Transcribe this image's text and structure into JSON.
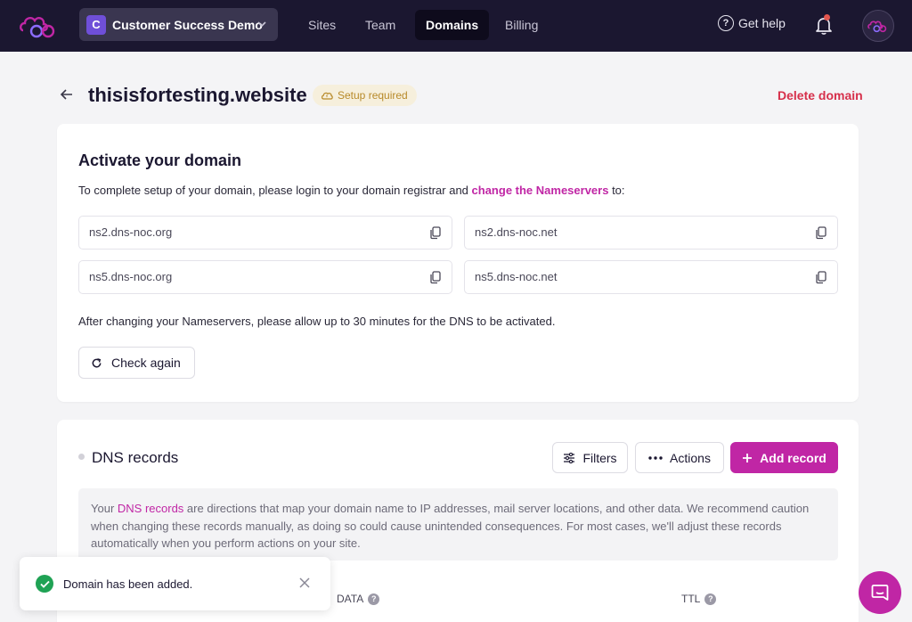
{
  "nav": {
    "workspace_initial": "C",
    "workspace_name": "Customer Success Demo",
    "items": [
      {
        "label": "Sites",
        "active": false
      },
      {
        "label": "Team",
        "active": false
      },
      {
        "label": "Domains",
        "active": true
      },
      {
        "label": "Billing",
        "active": false
      }
    ],
    "help_label": "Get help",
    "help_icon": "?"
  },
  "header": {
    "domain": "thisisfortesting.website",
    "status_badge": "Setup required",
    "delete_label": "Delete domain"
  },
  "activate": {
    "title": "Activate your domain",
    "desc_before": "To complete setup of your domain, please login to your domain registrar and ",
    "desc_link": "change the Nameservers",
    "desc_after": " to:",
    "nameservers": [
      "ns2.dns-noc.org",
      "ns2.dns-noc.net",
      "ns5.dns-noc.org",
      "ns5.dns-noc.net"
    ],
    "after_text": "After changing your Nameservers, please allow up to 30 minutes for the DNS to be activated.",
    "check_label": "Check again"
  },
  "dns": {
    "title": "DNS records",
    "filters_label": "Filters",
    "actions_label": "Actions",
    "add_label": "Add record",
    "info_before": "Your ",
    "info_link": "DNS records",
    "info_after": " are directions that map your domain name to IP addresses, mail server locations, and other data. We recommend caution when changing these records manually, as doing so could cause unintended consequences. For most cases, we'll adjust these records automatically when you perform actions on your site.",
    "columns": [
      "DATA",
      "TTL"
    ],
    "column_help_icon": "?"
  },
  "toast": {
    "message": "Domain has been added."
  },
  "colors": {
    "accent": "#c026a5",
    "nav_bg": "#1b1730",
    "danger": "#d6304b",
    "success": "#1fa254",
    "warning": "#b88a2a"
  }
}
